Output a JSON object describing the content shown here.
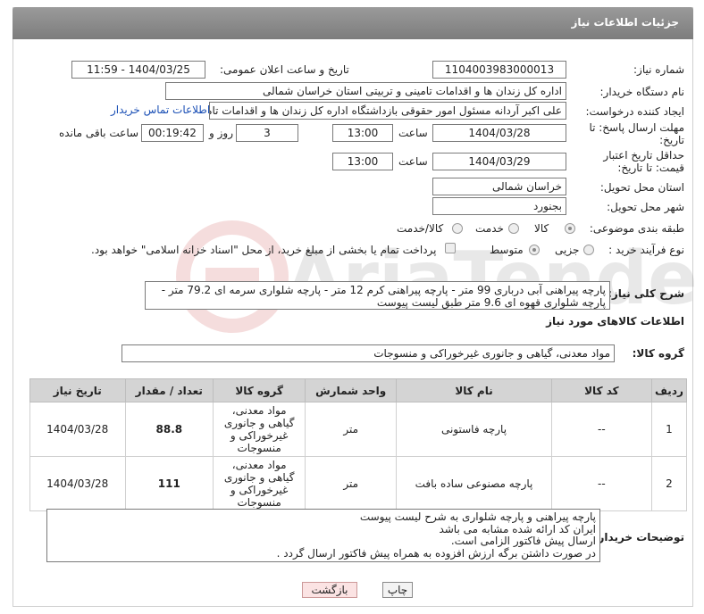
{
  "header": {
    "title": "جزئیات اطلاعات نیاز"
  },
  "labels": {
    "need_number": "شماره نیاز:",
    "announce_date": "تاریخ و ساعت اعلان عمومی:",
    "buyer_org": "نام دستگاه خریدار:",
    "requester": "ایجاد کننده درخواست:",
    "deadline": "مهلت ارسال پاسخ: تا تاریخ:",
    "time": "ساعت",
    "day_and": "روز و",
    "remaining": "ساعت باقی مانده",
    "min_validity": "حداقل تاریخ اعتبار قیمت: تا تاریخ:",
    "time2": "ساعت",
    "province": "استان محل تحویل:",
    "city": "شهر محل تحویل:",
    "category": "طبقه بندی موضوعی:",
    "process_type": "نوع فرآیند خرید :",
    "general_desc": "شرح کلی نیاز:",
    "goods_info": "اطلاعات کالاهای مورد نیاز",
    "goods_group": "گروه کالا:",
    "buyer_notes": "توضیحات خریدار:"
  },
  "values": {
    "need_number": "1104003983000013",
    "announce_date": "1404/03/25 - 11:59",
    "buyer_org": "اداره کل زندان ها و اقدامات تامینی و تربیتی استان خراسان شمالی",
    "requester": "علی اکبر آردانه مسئول امور حقوقی بازداشتگاه اداره کل زندان ها و اقدامات تامی",
    "contact_link": "اطلاعات تماس خریدار",
    "deadline_date": "1404/03/28",
    "deadline_time": "13:00",
    "days": "3",
    "remaining_time": "00:19:42",
    "validity_date": "1404/03/29",
    "validity_time": "13:00",
    "province": "خراسان شمالی",
    "city": "بجنورد",
    "general_desc": "پارچه پیراهنی آبی درباری 99 متر - پارچه پیراهنی کرم 12 متر - پارچه شلواری سرمه ای 79.2 متر - پارچه شلواری قهوه ای 9.6 متر طبق لیست پیوست",
    "goods_group": "مواد معدنی، گیاهی و جانوری غیرخوراکی و منسوجات",
    "buyer_notes": [
      "پارچه پیراهنی و پارچه شلواری به شرح لیست پیوست",
      "ایران کد ارائه شده مشابه می باشد",
      "ارسال پیش فاکتور الزامی است.",
      "در صورت داشتن برگه ارزش افزوده به همراه پیش فاکتور ارسال گردد ."
    ]
  },
  "category_options": {
    "goods": "کالا",
    "service": "خدمت",
    "goods_service": "کالا/خدمت"
  },
  "process_options": {
    "minor": "جزیی",
    "medium": "متوسط",
    "payment_note": "پرداخت تمام یا بخشی از مبلغ خرید، از محل \"اسناد خزانه اسلامی\" خواهد بود."
  },
  "table": {
    "headers": [
      "ردیف",
      "کد کالا",
      "نام کالا",
      "واحد شمارش",
      "گروه کالا",
      "تعداد / مقدار",
      "تاریخ نیاز"
    ],
    "rows": [
      [
        "1",
        "--",
        "پارچه فاستونی",
        "متر",
        "مواد معدنی، گیاهی و جانوری غیرخوراکی و منسوجات",
        "88.8",
        "1404/03/28"
      ],
      [
        "2",
        "--",
        "پارچه مصنوعی ساده بافت",
        "متر",
        "مواد معدنی، گیاهی و جانوری غیرخوراکی و منسوجات",
        "111",
        "1404/03/28"
      ]
    ]
  },
  "buttons": {
    "print": "چاپ",
    "back": "بازگشت"
  },
  "watermark": {
    "brand": "AriaTender.neT"
  }
}
